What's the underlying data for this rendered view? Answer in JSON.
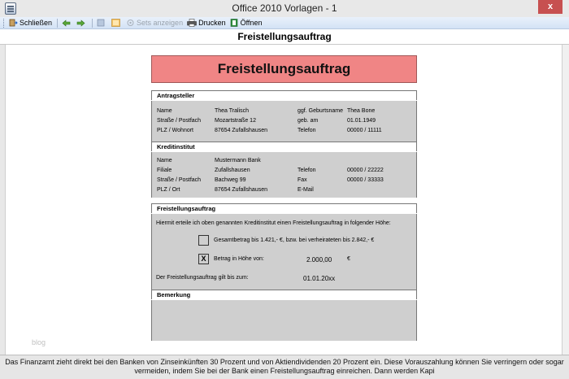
{
  "window": {
    "title": "Office 2010 Vorlagen - 1",
    "close_glyph": "x"
  },
  "toolbar": {
    "close_label": "Schließen",
    "sets_label": "Sets anzeigen",
    "print_label": "Drucken",
    "open_label": "Öffnen"
  },
  "header": {
    "title": "Freistellungsauftrag"
  },
  "document": {
    "banner": "Freistellungsauftrag",
    "antragsteller": {
      "heading": "Antragsteller",
      "rows": [
        [
          "Name",
          "Thea Tralisch",
          "ggf. Geburtsname",
          "Thea Bone"
        ],
        [
          "Straße / Postfach",
          "Mozartstraße 12",
          "geb. am",
          "01.01.1949"
        ],
        [
          "PLZ / Wohnort",
          "87654 Zufallshausen",
          "Telefon",
          "00000 / 11111"
        ]
      ]
    },
    "kreditinstitut": {
      "heading": "Kreditinstitut",
      "rows": [
        [
          "Name",
          "Mustermann Bank",
          "",
          ""
        ],
        [
          "Filiale",
          "Zufallshausen",
          "Telefon",
          "00000 / 22222"
        ],
        [
          "Straße / Postfach",
          "Bachweg 99",
          "Fax",
          "00000 / 33333"
        ],
        [
          "PLZ / Ort",
          "87654 Zufallshausen",
          "E-Mail",
          ""
        ]
      ]
    },
    "freistellung": {
      "heading": "Freistellungsauftrag",
      "intro": "Hiermit erteile ich oben genannten Kreditinstitut einen Freistellungsauftrag in folgender Höhe:",
      "option1_checked": "",
      "option1_text": "Gesamtbetrag bis 1.421,- €, bzw. bei verheirateten bis 2.842,- €",
      "option2_checked": "X",
      "option2_text": "Betrag in Höhe von:",
      "amount": "2.000,00",
      "currency": "€",
      "valid_label": "Der Freistellungsauftrag gilt bis zum:",
      "valid_date": "01.01.20xx"
    },
    "bemerkung": {
      "heading": "Bemerkung"
    }
  },
  "watermark": "blog",
  "status": {
    "text": "Das Finanzamt zieht direkt bei den Banken von Zinseinkünften 30 Prozent und von Aktiendividenden 20 Prozent ein. Diese Vorauszahlung können Sie verringern oder sogar vermeiden, indem Sie bei der Bank einen Freistellungsauftrag einreichen. Dann werden Kapi"
  },
  "colors": {
    "banner": "#f08585",
    "section_bg": "#cfcfcf",
    "toolbar_bg": "#d3e2f5",
    "close_button": "#c75050"
  },
  "icons": [
    "app-icon",
    "close-door-icon",
    "back-arrow-icon",
    "forward-arrow-icon",
    "sets-icon",
    "print-icon",
    "open-icon"
  ]
}
